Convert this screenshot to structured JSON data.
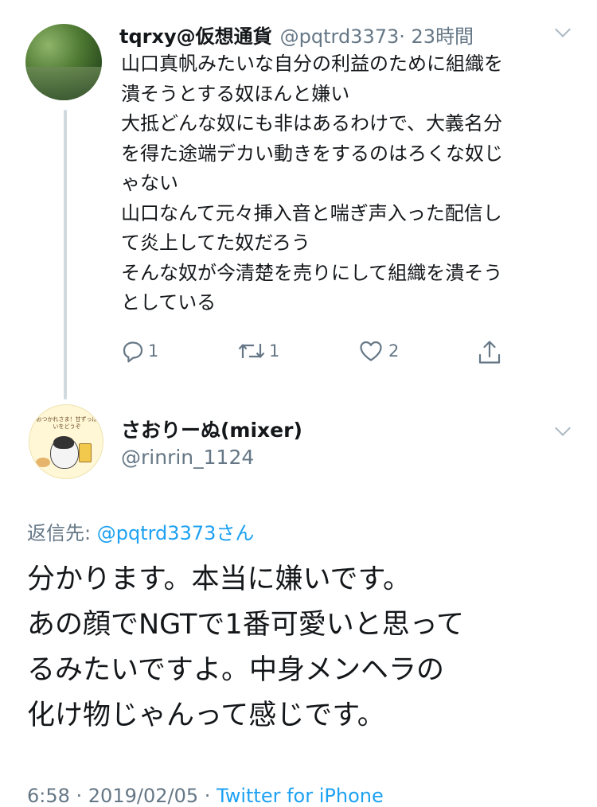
{
  "tweet1": {
    "name": "tqrxy@仮想通貨",
    "handle": "@pqtrd3373",
    "time": "· 23時間",
    "lines": [
      "山口真帆みたいな自分の利益のために組織を",
      "潰そうとする奴ほんと嫌い",
      "大抵どんな奴にも非はあるわけで、大義名分",
      "を得た途端デカい動きをするのはろくな奴じ",
      "ゃない",
      "山口なんて元々挿入音と喘ぎ声入った配信し",
      "て炎上してた奴だろう",
      "そんな奴が今清楚を売りにして組織を潰そう",
      "としている"
    ],
    "reply_count": "1",
    "retweet_count": "1",
    "like_count": "2"
  },
  "tweet2": {
    "name": "さおりーぬ(mixer)",
    "handle": "@rinrin_1124",
    "avatar_text": "おつかれさま！甘ずっぱいをどうぞ",
    "reply_label": "返信先:",
    "reply_mention": "@pqtrd3373さん",
    "lines": [
      "分かります。本当に嫌いです。",
      "あの顔でNGTで1番可愛いと思って",
      "るみたいですよ。中身メンヘラの",
      "化け物じゃんって感じです。"
    ],
    "timestamp": "6:58 · 2019/02/05 ·",
    "source": "Twitter for iPhone"
  },
  "colors": {
    "text": "#14171a",
    "secondary": "#657786",
    "link": "#1da1f2",
    "thread_line": "#cfd9de"
  },
  "icons": [
    "reply-icon",
    "retweet-icon",
    "like-icon",
    "share-icon",
    "chevron-down-icon"
  ]
}
